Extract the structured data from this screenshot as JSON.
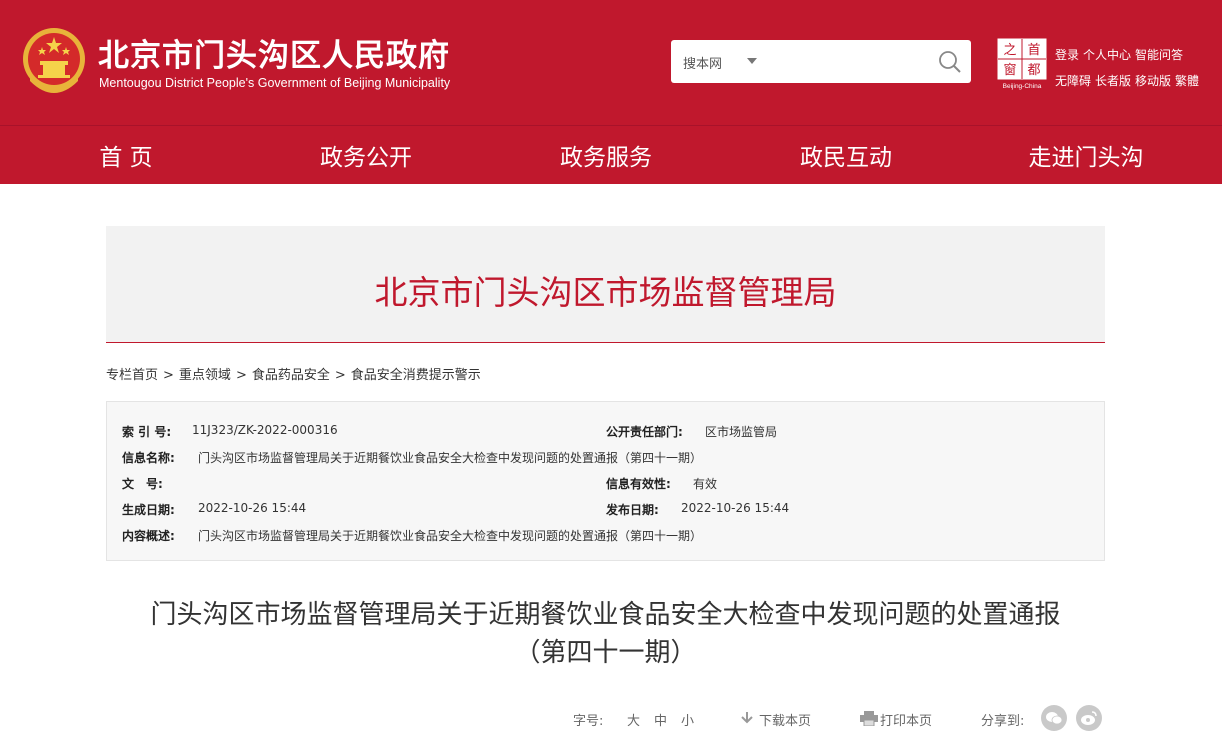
{
  "header": {
    "title": "北京市门头沟区人民政府",
    "subtitle": "Mentougou District People's Government of Beijing Municipality",
    "search": {
      "scope": "搜本网",
      "placeholder": ""
    },
    "badge_chars": [
      "之",
      "首",
      "窗",
      "都"
    ],
    "badge_caption": "Beijing-China",
    "links_row1": [
      "登录",
      "个人中心",
      "智能问答"
    ],
    "links_row2": [
      "无障碍",
      "长者版",
      "移动版",
      "繁體"
    ]
  },
  "nav": [
    "首 页",
    "政务公开",
    "政务服务",
    "政民互动",
    "走进门头沟"
  ],
  "banner": {
    "title": "北京市门头沟区市场监督管理局"
  },
  "breadcrumb": [
    "专栏首页",
    "重点领域",
    "食品药品安全",
    "食品安全消费提示警示"
  ],
  "info": {
    "index_label": "索 引 号:",
    "index_value": "11J323/ZK-2022-000316",
    "dept_label": "公开责任部门:",
    "dept_value": "区市场监管局",
    "name_label": "信息名称:",
    "name_value": "门头沟区市场监督管理局关于近期餐饮业食品安全大检查中发现问题的处置通报（第四十一期）",
    "doc_label": "文　号:",
    "doc_value": "",
    "validity_label": "信息有效性:",
    "validity_value": "有效",
    "created_label": "生成日期:",
    "created_value": "2022-10-26 15:44",
    "published_label": "发布日期:",
    "published_value": "2022-10-26 15:44",
    "summary_label": "内容概述:",
    "summary_value": "门头沟区市场监督管理局关于近期餐饮业食品安全大检查中发现问题的处置通报（第四十一期）"
  },
  "article": {
    "title_line1": "门头沟区市场监督管理局关于近期餐饮业食品安全大检查中发现问题的处置通报",
    "title_line2": "（第四十一期）"
  },
  "tools": {
    "font_label": "字号:",
    "font_large": "大",
    "font_medium": "中",
    "font_small": "小",
    "download": "下载本页",
    "print": "打印本页",
    "share": "分享到:"
  },
  "colors": {
    "brand": "#c0182d",
    "banner_bg": "#f2f2f2",
    "info_bg": "#f7f7f7"
  }
}
